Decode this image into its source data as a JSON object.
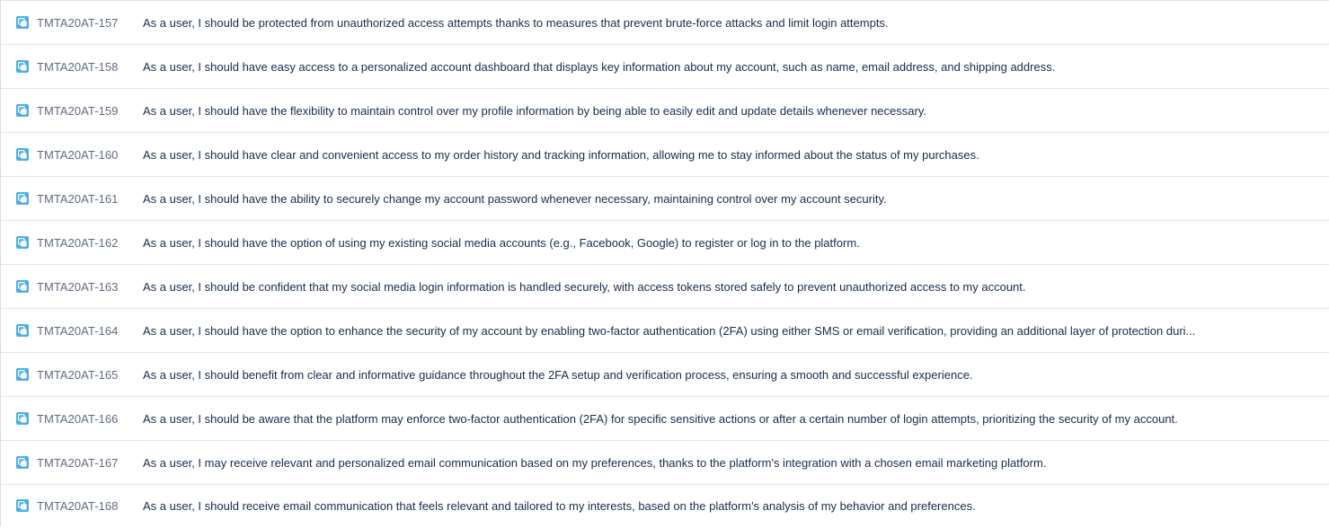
{
  "colors": {
    "story_icon": "#4bade8",
    "key_text": "#5e6c84",
    "summary_text": "#172b4d",
    "row_border": "#e3e3e3"
  },
  "issues": [
    {
      "icon": "story-icon",
      "key": "TMTA20AT-157",
      "summary": "As a user, I should be protected from unauthorized access attempts thanks to measures that prevent brute-force attacks and limit login attempts."
    },
    {
      "icon": "story-icon",
      "key": "TMTA20AT-158",
      "summary": "As a user, I should have easy access to a personalized account dashboard that displays key information about my account, such as name, email address, and shipping address."
    },
    {
      "icon": "story-icon",
      "key": "TMTA20AT-159",
      "summary": "As a user, I should have the flexibility to maintain control over my profile information by being able to easily edit and update details whenever necessary."
    },
    {
      "icon": "story-icon",
      "key": "TMTA20AT-160",
      "summary": "As a user, I should have clear and convenient access to my order history and tracking information, allowing me to stay informed about the status of my purchases."
    },
    {
      "icon": "story-icon",
      "key": "TMTA20AT-161",
      "summary": "As a user, I should have the ability to securely change my account password whenever necessary, maintaining control over my account security."
    },
    {
      "icon": "story-icon",
      "key": "TMTA20AT-162",
      "summary": "As a user, I should have the option of using my existing social media accounts (e.g., Facebook, Google) to register or log in to the platform."
    },
    {
      "icon": "story-icon",
      "key": "TMTA20AT-163",
      "summary": "As a user, I should be confident that my social media login information is handled securely, with access tokens stored safely to prevent unauthorized access to my account."
    },
    {
      "icon": "story-icon",
      "key": "TMTA20AT-164",
      "summary": "As a user, I should have the option to enhance the security of my account by enabling two-factor authentication (2FA) using either SMS or email verification, providing an additional layer of protection duri..."
    },
    {
      "icon": "story-icon",
      "key": "TMTA20AT-165",
      "summary": "As a user, I should benefit from clear and informative guidance throughout the 2FA setup and verification process, ensuring a smooth and successful experience."
    },
    {
      "icon": "story-icon",
      "key": "TMTA20AT-166",
      "summary": "As a user, I should be aware that the platform may enforce two-factor authentication (2FA) for specific sensitive actions or after a certain number of login attempts, prioritizing the security of my account."
    },
    {
      "icon": "story-icon",
      "key": "TMTA20AT-167",
      "summary": "As a user, I may receive relevant and personalized email communication based on my preferences, thanks to the platform's integration with a chosen email marketing platform."
    },
    {
      "icon": "story-icon",
      "key": "TMTA20AT-168",
      "summary": "As a user, I should receive email communication that feels relevant and tailored to my interests, based on the platform's analysis of my behavior and preferences."
    }
  ]
}
